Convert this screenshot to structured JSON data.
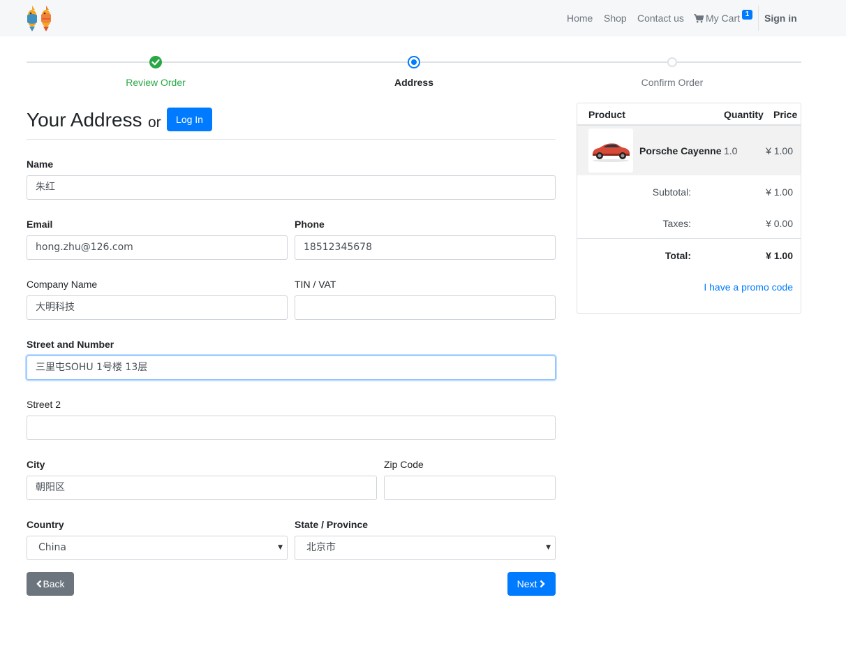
{
  "nav": {
    "home": "Home",
    "shop": "Shop",
    "contact": "Contact us",
    "cart": "My Cart",
    "cart_count": "1",
    "signin": "Sign in"
  },
  "steps": [
    {
      "label": "Review Order",
      "status": "done"
    },
    {
      "label": "Address",
      "status": "current"
    },
    {
      "label": "Confirm Order",
      "status": "todo"
    }
  ],
  "heading": {
    "title": "Your Address",
    "or": "or",
    "login_label": "Log In"
  },
  "form": {
    "name": {
      "label": "Name",
      "value": "朱红"
    },
    "email": {
      "label": "Email",
      "value": "hong.zhu@126.com"
    },
    "phone": {
      "label": "Phone",
      "value": "18512345678"
    },
    "company": {
      "label": "Company Name",
      "value": "大明科技"
    },
    "vat": {
      "label": "TIN / VAT",
      "value": ""
    },
    "street": {
      "label": "Street and Number",
      "value": "三里屯SOHU 1号楼 13层"
    },
    "street2": {
      "label": "Street 2",
      "value": ""
    },
    "city": {
      "label": "City",
      "value": "朝阳区"
    },
    "zip": {
      "label": "Zip Code",
      "value": ""
    },
    "country": {
      "label": "Country",
      "value": "China"
    },
    "state": {
      "label": "State / Province",
      "value": "北京市"
    }
  },
  "buttons": {
    "back": "Back",
    "next": "Next"
  },
  "cart": {
    "headers": {
      "product": "Product",
      "quantity": "Quantity",
      "price": "Price"
    },
    "items": [
      {
        "name": "Porsche Cayenne",
        "quantity": "1.0",
        "price": "¥ 1.00"
      }
    ],
    "subtotal_label": "Subtotal:",
    "subtotal": "¥ 1.00",
    "taxes_label": "Taxes:",
    "taxes": "¥ 0.00",
    "total_label": "Total:",
    "total": "¥ 1.00",
    "promo": "I have a promo code"
  },
  "colors": {
    "primary": "#007bff",
    "success": "#28a745",
    "secondary": "#6c757d"
  }
}
